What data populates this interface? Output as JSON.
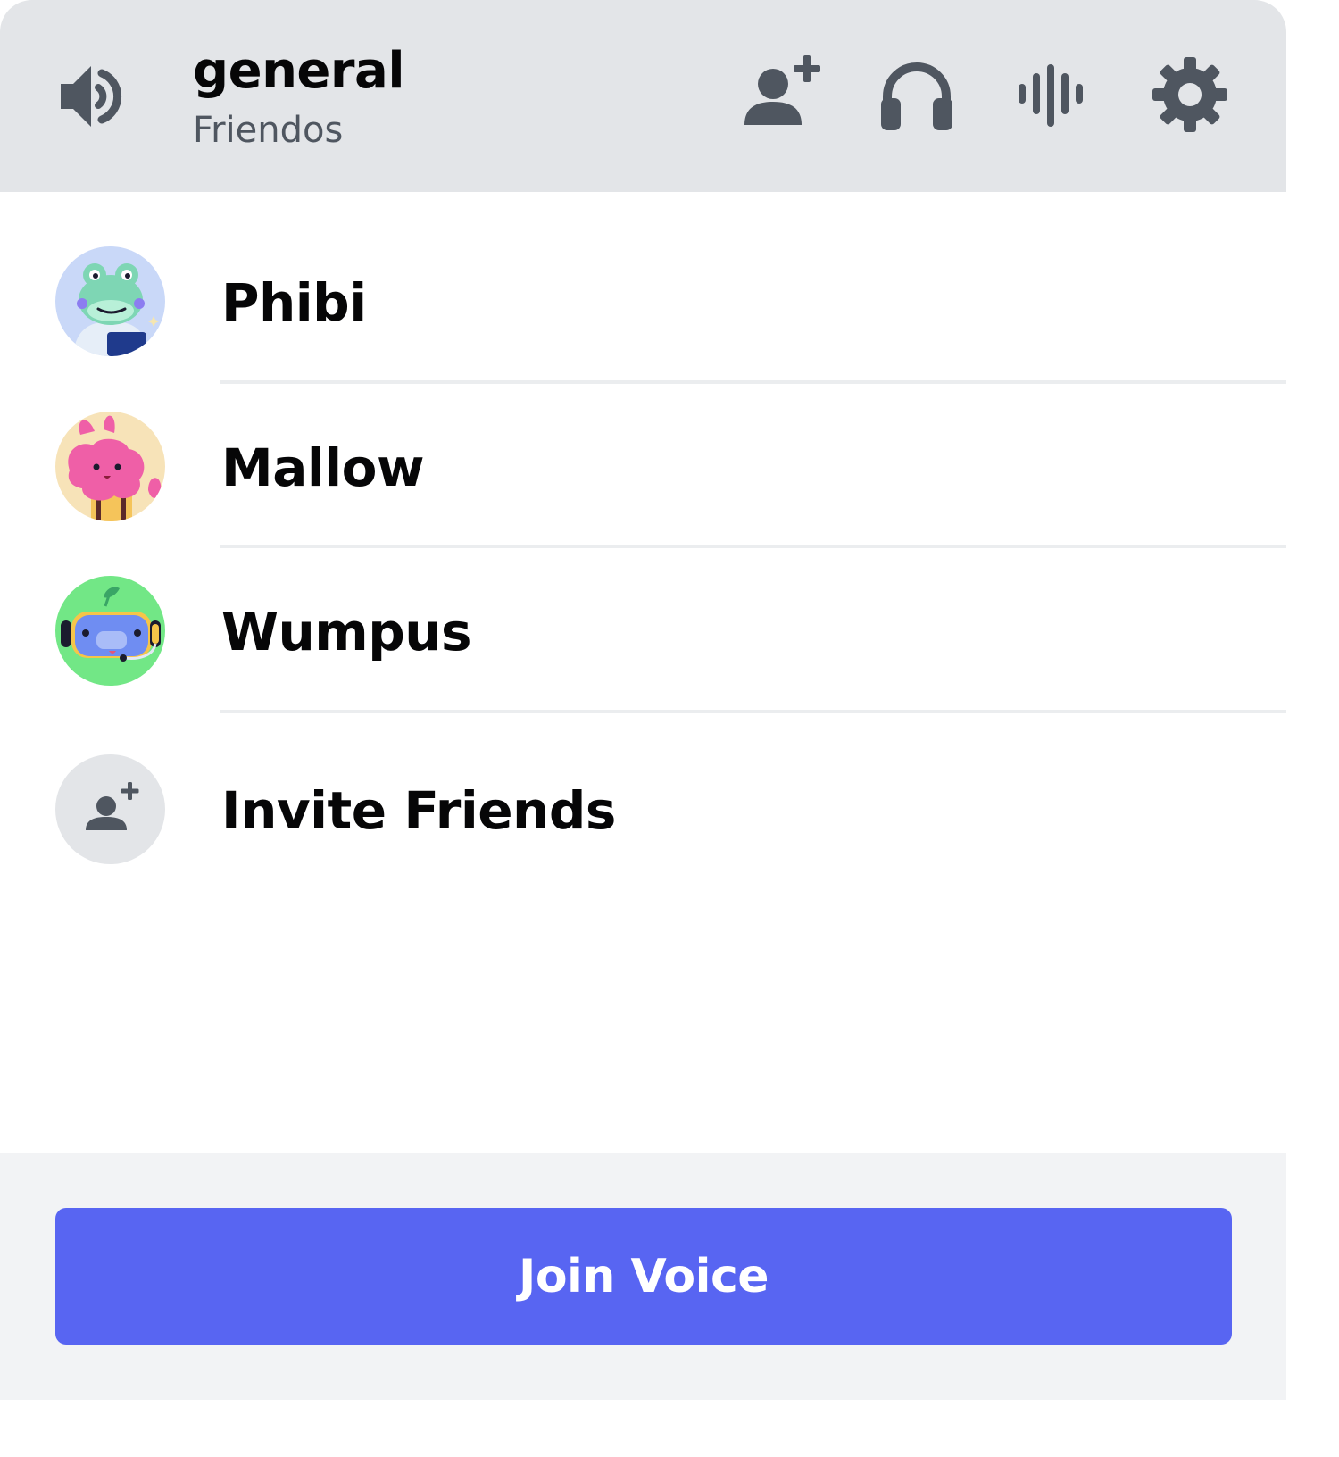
{
  "header": {
    "icon": "speaker-icon",
    "title": "general",
    "subtitle": "Friendos",
    "actions": [
      {
        "icon": "add-friend-icon"
      },
      {
        "icon": "headphones-icon"
      },
      {
        "icon": "soundboard-icon"
      },
      {
        "icon": "gear-icon"
      }
    ]
  },
  "members": [
    {
      "name": "Phibi",
      "avatar": "frog-avatar"
    },
    {
      "name": "Mallow",
      "avatar": "bunny-avatar"
    },
    {
      "name": "Wumpus",
      "avatar": "wumpus-avatar"
    }
  ],
  "invite": {
    "label": "Invite Friends",
    "icon": "add-friend-icon"
  },
  "footer": {
    "join_label": "Join Voice"
  },
  "colors": {
    "header_bg": "#e3e5e8",
    "icon": "#4f5660",
    "accent": "#5865f2",
    "footer_bg": "#f2f3f5",
    "text": "#060607"
  }
}
